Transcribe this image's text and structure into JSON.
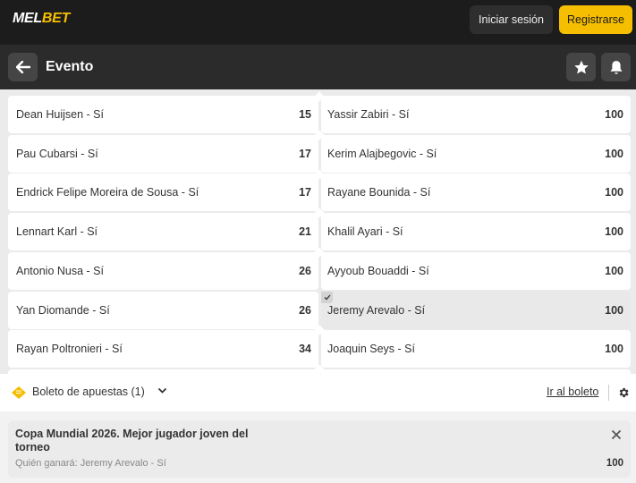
{
  "header": {
    "logo_part1": "MEL",
    "logo_part2": "BET",
    "login_label": "Iniciar sesión",
    "register_label": "Registrarse"
  },
  "subheader": {
    "title": "Evento",
    "back_icon": "arrow-left-icon",
    "favorite_icon": "star-icon",
    "notify_icon": "bell-icon"
  },
  "rows": [
    {
      "left": {
        "name": "Dean Huijsen - Sí",
        "odd": "15"
      },
      "right": {
        "name": "Yassir Zabiri - Sí",
        "odd": "100",
        "selected": false
      }
    },
    {
      "left": {
        "name": "Pau Cubarsi - Sí",
        "odd": "17"
      },
      "right": {
        "name": "Kerim Alajbegovic - Sí",
        "odd": "100",
        "selected": false
      }
    },
    {
      "left": {
        "name": "Endrick Felipe Moreira de Sousa - Sí",
        "odd": "17"
      },
      "right": {
        "name": "Rayane Bounida - Sí",
        "odd": "100",
        "selected": false
      }
    },
    {
      "left": {
        "name": "Lennart Karl - Sí",
        "odd": "21"
      },
      "right": {
        "name": "Khalil Ayari - Sí",
        "odd": "100",
        "selected": false
      }
    },
    {
      "left": {
        "name": "Antonio Nusa - Sí",
        "odd": "26"
      },
      "right": {
        "name": "Ayyoub Bouaddi - Sí",
        "odd": "100",
        "selected": false
      }
    },
    {
      "left": {
        "name": "Yan Diomande - Sí",
        "odd": "26"
      },
      "right": {
        "name": "Jeremy Arevalo - Sí",
        "odd": "100",
        "selected": true
      }
    },
    {
      "left": {
        "name": "Rayan Poltronieri - Sí",
        "odd": "34"
      },
      "right": {
        "name": "Joaquin Seys - Sí",
        "odd": "100",
        "selected": false
      }
    }
  ],
  "betslip": {
    "label": "Boleto de apuestas (1)",
    "goto_label": "Ir al boleto"
  },
  "bet": {
    "title": "Copa Mundial 2026. Mejor jugador joven del torneo",
    "selection": "Quién ganará: Jeremy Arevalo - Sí",
    "odd": "100"
  },
  "colors": {
    "accent": "#f6be00",
    "topbar": "#1c1c1c",
    "subheader": "#2b2b2b"
  }
}
